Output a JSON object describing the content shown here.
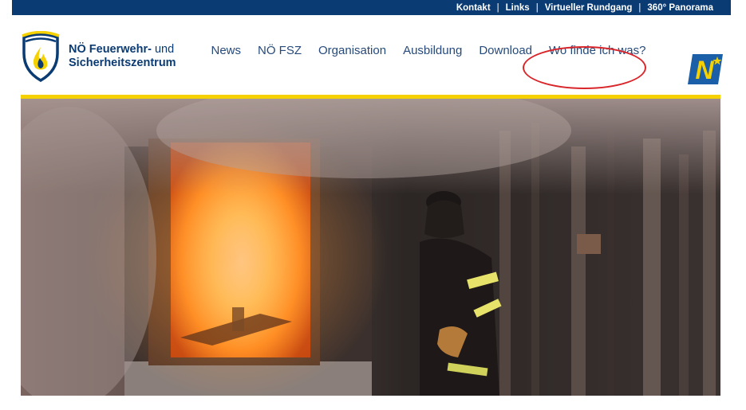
{
  "topbar": {
    "links": [
      "Kontakt",
      "Links",
      "Virtueller Rundgang",
      "360° Panorama"
    ],
    "separator": "|"
  },
  "logo": {
    "line1_bold": "NÖ Feuerwehr-",
    "line1_light": " und",
    "line2": "Sicherheitszentrum"
  },
  "nav": {
    "items": [
      "News",
      "NÖ FSZ",
      "Organisation",
      "Ausbildung",
      "Download",
      "Wo finde ich was?"
    ]
  },
  "noe_logo": {
    "letter": "N"
  },
  "colors": {
    "brand_blue": "#0b3b73",
    "accent_yellow": "#f5d100",
    "annotation_red": "#d8262b"
  },
  "icons": [
    "fire-service-shield-logo",
    "noe-state-logo"
  ]
}
